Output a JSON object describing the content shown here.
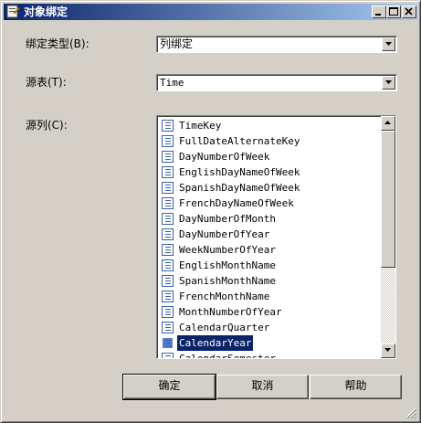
{
  "window": {
    "title": "对象绑定",
    "title_icon": "app-window-icon"
  },
  "title_buttons": {
    "minimize": "minimize-icon",
    "maximize": "maximize-icon",
    "close": "close-icon"
  },
  "binding_type": {
    "label": "绑定类型(B):",
    "value": "列绑定"
  },
  "source_table": {
    "label": "源表(T):",
    "value": "Time"
  },
  "source_column": {
    "label": "源列(C):",
    "selected": "CalendarYear",
    "items": [
      "TimeKey",
      "FullDateAlternateKey",
      "DayNumberOfWeek",
      "EnglishDayNameOfWeek",
      "SpanishDayNameOfWeek",
      "FrenchDayNameOfWeek",
      "DayNumberOfMonth",
      "DayNumberOfYear",
      "WeekNumberOfYear",
      "EnglishMonthName",
      "SpanishMonthName",
      "FrenchMonthName",
      "MonthNumberOfYear",
      "CalendarQuarter",
      "CalendarYear",
      "CalendarSemester"
    ]
  },
  "buttons": {
    "ok": "确定",
    "cancel": "取消",
    "help": "帮助"
  },
  "colors": {
    "title_start": "#0a246a",
    "title_end": "#a6caf0",
    "face": "#d4d0c8",
    "selection": "#0a246a"
  }
}
